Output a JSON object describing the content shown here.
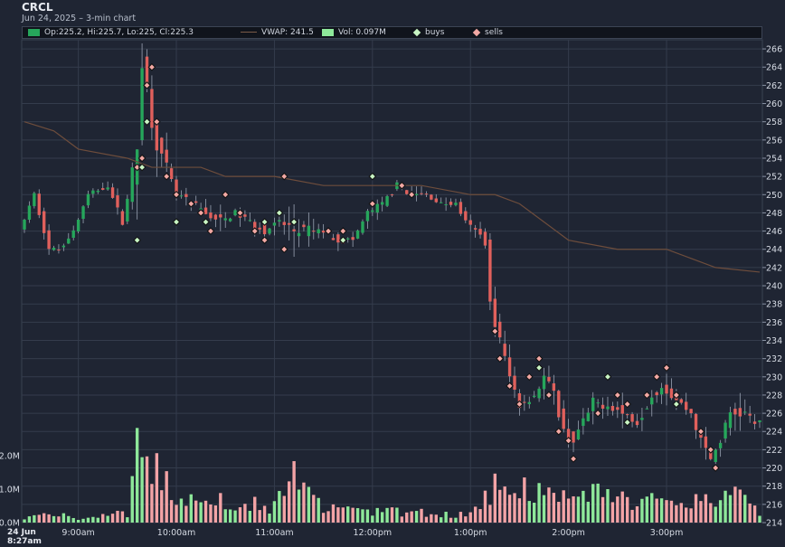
{
  "symbol": "CRCL",
  "subtitle": "Jun 24, 2025 – 3-min chart",
  "legend": {
    "ohlc": "Op:225.2, Hi:225.7, Lo:225, Cl:225.3",
    "vwap": "VWAP: 241.5",
    "vol": "Vol: 0.097M",
    "buys": "buys",
    "sells": "sells"
  },
  "corner_date": "24 Jun",
  "corner_time": "8:27am",
  "colors": {
    "up": "#26a65b",
    "down": "#e0605c",
    "vwap": "#6e4d3c",
    "vol_up": "#8ee89a",
    "vol_down": "#f3a3a6",
    "buy": "#c8f5c4",
    "sell": "#f2a8a4",
    "grid": "#343c4c",
    "axis": "#d6dbe4"
  },
  "chart_data": {
    "type": "candlestick",
    "interval_minutes": 3,
    "x_range": [
      "08:27",
      "15:57"
    ],
    "x_ticks": [
      "9:00am",
      "10:00am",
      "11:00am",
      "12:00pm",
      "1:00pm",
      "2:00pm",
      "3:00pm"
    ],
    "y_range": [
      214,
      267
    ],
    "y_ticks": [
      214,
      216,
      218,
      220,
      222,
      224,
      226,
      228,
      230,
      232,
      234,
      236,
      238,
      240,
      242,
      244,
      246,
      248,
      250,
      252,
      254,
      256,
      258,
      260,
      262,
      264,
      266
    ],
    "volume_ticks": [
      "0.0M",
      "1.0M",
      "2.0M"
    ],
    "volume_range_m": [
      0,
      2.4
    ],
    "price_path": [
      [
        "08:27",
        246
      ],
      [
        "08:36",
        250
      ],
      [
        "08:45",
        244
      ],
      [
        "08:51",
        244
      ],
      [
        "09:00",
        246
      ],
      [
        "09:09",
        250
      ],
      [
        "09:21",
        251
      ],
      [
        "09:30",
        247
      ],
      [
        "09:39",
        255
      ],
      [
        "09:42",
        265
      ],
      [
        "09:48",
        258
      ],
      [
        "09:54",
        254
      ],
      [
        "10:03",
        250
      ],
      [
        "10:12",
        249
      ],
      [
        "10:21",
        248
      ],
      [
        "10:30",
        247
      ],
      [
        "10:39",
        248
      ],
      [
        "10:48",
        247
      ],
      [
        "10:57",
        246
      ],
      [
        "11:06",
        247
      ],
      [
        "11:15",
        246
      ],
      [
        "11:24",
        246
      ],
      [
        "11:33",
        246
      ],
      [
        "11:42",
        245
      ],
      [
        "11:51",
        245
      ],
      [
        "12:00",
        248
      ],
      [
        "12:09",
        249
      ],
      [
        "12:18",
        251
      ],
      [
        "12:27",
        250
      ],
      [
        "12:36",
        250
      ],
      [
        "12:45",
        249
      ],
      [
        "12:54",
        249
      ],
      [
        "13:00",
        247
      ],
      [
        "13:06",
        246
      ],
      [
        "13:12",
        245
      ],
      [
        "13:15",
        238
      ],
      [
        "13:21",
        234
      ],
      [
        "13:27",
        230
      ],
      [
        "13:33",
        227
      ],
      [
        "13:42",
        228
      ],
      [
        "13:48",
        230
      ],
      [
        "13:54",
        228
      ],
      [
        "14:00",
        224
      ],
      [
        "14:06",
        223
      ],
      [
        "14:12",
        225
      ],
      [
        "14:18",
        227
      ],
      [
        "14:27",
        227
      ],
      [
        "14:36",
        226
      ],
      [
        "14:45",
        225
      ],
      [
        "14:54",
        228
      ],
      [
        "15:00",
        229
      ],
      [
        "15:06",
        228
      ],
      [
        "15:12",
        227
      ],
      [
        "15:18",
        226
      ],
      [
        "15:24",
        223
      ],
      [
        "15:30",
        221
      ],
      [
        "15:36",
        223
      ],
      [
        "15:42",
        226
      ],
      [
        "15:51",
        226
      ],
      [
        "15:57",
        225
      ]
    ],
    "vwap": [
      [
        "08:27",
        258
      ],
      [
        "08:45",
        257
      ],
      [
        "09:00",
        255
      ],
      [
        "09:30",
        254
      ],
      [
        "09:45",
        253
      ],
      [
        "10:00",
        253
      ],
      [
        "10:15",
        253
      ],
      [
        "10:30",
        252
      ],
      [
        "11:00",
        252
      ],
      [
        "11:30",
        251
      ],
      [
        "12:00",
        251
      ],
      [
        "12:30",
        251
      ],
      [
        "13:00",
        250
      ],
      [
        "13:15",
        250
      ],
      [
        "13:30",
        249
      ],
      [
        "13:45",
        247
      ],
      [
        "14:00",
        245
      ],
      [
        "14:30",
        244
      ],
      [
        "15:00",
        244
      ],
      [
        "15:15",
        243
      ],
      [
        "15:30",
        242
      ],
      [
        "15:57",
        241.5
      ]
    ],
    "volume_m": [
      [
        "08:27",
        0.15
      ],
      [
        "08:51",
        0.2
      ],
      [
        "09:00",
        0.1
      ],
      [
        "09:30",
        0.25
      ],
      [
        "09:36",
        1.8
      ],
      [
        "09:42",
        1.2
      ],
      [
        "09:48",
        1.5
      ],
      [
        "10:00",
        0.5
      ],
      [
        "10:30",
        0.6
      ],
      [
        "11:00",
        0.4
      ],
      [
        "11:12",
        1.1
      ],
      [
        "11:30",
        0.35
      ],
      [
        "12:00",
        0.3
      ],
      [
        "12:30",
        0.25
      ],
      [
        "13:00",
        0.2
      ],
      [
        "13:15",
        0.95
      ],
      [
        "13:30",
        0.9
      ],
      [
        "13:45",
        0.75
      ],
      [
        "14:00",
        0.6
      ],
      [
        "14:15",
        0.75
      ],
      [
        "14:30",
        0.6
      ],
      [
        "14:45",
        0.55
      ],
      [
        "15:00",
        0.5
      ],
      [
        "15:15",
        0.55
      ],
      [
        "15:30",
        0.65
      ],
      [
        "15:45",
        0.7
      ],
      [
        "15:57",
        0.3
      ]
    ],
    "buys": [
      [
        "09:36",
        245
      ],
      [
        "09:39",
        253
      ],
      [
        "09:42",
        258
      ],
      [
        "10:00",
        247
      ],
      [
        "10:18",
        247
      ],
      [
        "10:54",
        247
      ],
      [
        "11:03",
        248
      ],
      [
        "11:12",
        247
      ],
      [
        "11:42",
        245
      ],
      [
        "12:00",
        252
      ],
      [
        "13:42",
        231
      ],
      [
        "14:24",
        230
      ],
      [
        "14:36",
        225
      ],
      [
        "15:06",
        227
      ]
    ],
    "sells": [
      [
        "09:36",
        253
      ],
      [
        "09:39",
        254
      ],
      [
        "09:42",
        262
      ],
      [
        "09:45",
        264
      ],
      [
        "09:48",
        258
      ],
      [
        "09:54",
        252
      ],
      [
        "10:00",
        250
      ],
      [
        "10:09",
        249
      ],
      [
        "10:15",
        248
      ],
      [
        "10:21",
        246
      ],
      [
        "10:30",
        250
      ],
      [
        "10:39",
        248
      ],
      [
        "10:48",
        246
      ],
      [
        "10:54",
        245
      ],
      [
        "11:06",
        252
      ],
      [
        "11:06",
        244
      ],
      [
        "11:33",
        246
      ],
      [
        "11:42",
        246
      ],
      [
        "12:00",
        249
      ],
      [
        "12:18",
        251
      ],
      [
        "12:24",
        250
      ],
      [
        "13:15",
        235
      ],
      [
        "13:18",
        232
      ],
      [
        "13:24",
        229
      ],
      [
        "13:30",
        227
      ],
      [
        "13:36",
        230
      ],
      [
        "13:42",
        232
      ],
      [
        "13:48",
        228
      ],
      [
        "13:54",
        224
      ],
      [
        "14:00",
        223
      ],
      [
        "14:03",
        221
      ],
      [
        "14:18",
        226
      ],
      [
        "14:30",
        228
      ],
      [
        "14:36",
        227
      ],
      [
        "14:48",
        228
      ],
      [
        "14:54",
        230
      ],
      [
        "15:00",
        231
      ],
      [
        "15:06",
        228
      ],
      [
        "15:21",
        224
      ],
      [
        "15:27",
        222
      ],
      [
        "15:30",
        220
      ]
    ]
  }
}
